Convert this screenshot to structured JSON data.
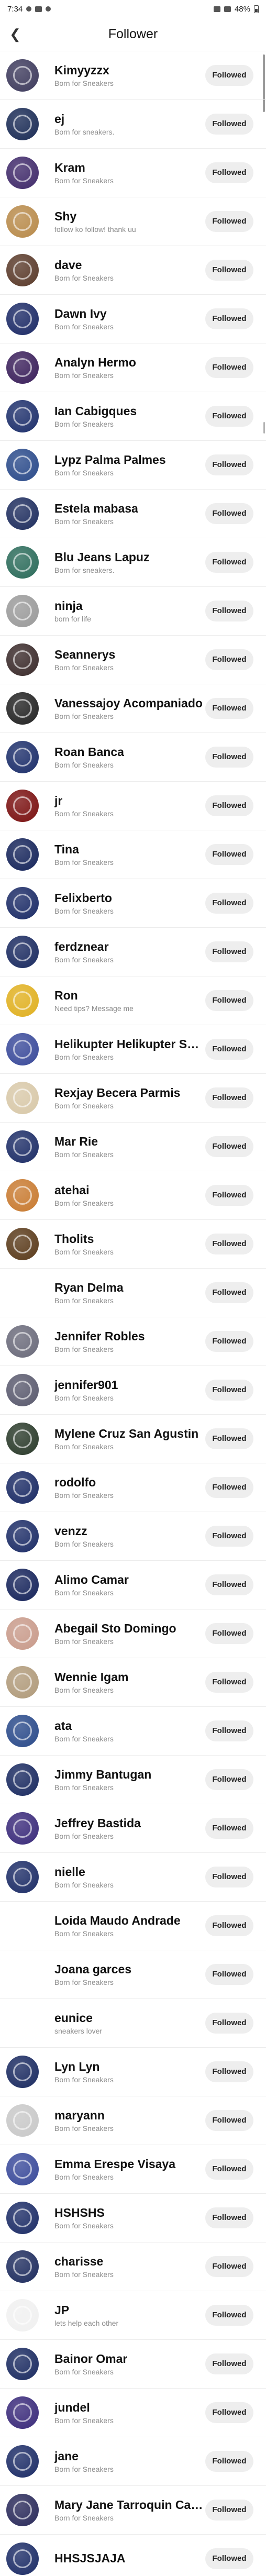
{
  "status": {
    "time": "7:34",
    "battery": "48%"
  },
  "header": {
    "title": "Follower",
    "back_icon": "back-arrow-icon"
  },
  "colors": {
    "button_bg": "#eeeeee",
    "subtitle": "#8c8c8c"
  },
  "followers": [
    {
      "name": "Kimyyzzx",
      "subtitle": "Born for Sneakers",
      "button": "Followed",
      "avatar_color": "#3d3a5c"
    },
    {
      "name": "ej",
      "subtitle": "Born for sneakers.",
      "button": "Followed",
      "avatar_color": "#1a2b55"
    },
    {
      "name": "Kram",
      "subtitle": "Born for Sneakers",
      "button": "Followed",
      "avatar_color": "#402a6a"
    },
    {
      "name": "Shy",
      "subtitle": "follow ko follow! thank uu",
      "button": "Followed",
      "avatar_color": "#b88a4a"
    },
    {
      "name": "dave",
      "subtitle": "Born for Sneakers",
      "button": "Followed",
      "avatar_color": "#5a3a2a"
    },
    {
      "name": "Dawn Ivy",
      "subtitle": "Born for Sneakers",
      "button": "Followed",
      "avatar_color": "#1c2a66"
    },
    {
      "name": "Analyn Hermo",
      "subtitle": "Born for Sneakers",
      "button": "Followed",
      "avatar_color": "#3a1f5a"
    },
    {
      "name": "Ian Cabigques",
      "subtitle": "Born for Sneakers",
      "button": "Followed",
      "avatar_color": "#1d2f6b"
    },
    {
      "name": "Lypz Palma Palmes",
      "subtitle": "Born for Sneakers",
      "button": "Followed",
      "avatar_color": "#2a4a8a"
    },
    {
      "name": "Estela mabasa",
      "subtitle": "Born for Sneakers",
      "button": "Followed",
      "avatar_color": "#1e2d5e"
    },
    {
      "name": "Blu Jeans Lapuz",
      "subtitle": "Born for sneakers.",
      "button": "Followed",
      "avatar_color": "#2b6b5a"
    },
    {
      "name": "ninja",
      "subtitle": "born for life",
      "button": "Followed",
      "avatar_color": "#9a9a9a"
    },
    {
      "name": "Seannerys",
      "subtitle": "Born for Sneakers",
      "button": "Followed",
      "avatar_color": "#3a2a2a"
    },
    {
      "name": "Vanessajoy Acompaniado",
      "subtitle": "Born for Sneakers",
      "button": "Followed",
      "avatar_color": "#222222"
    },
    {
      "name": "Roan Banca",
      "subtitle": "Born for Sneakers",
      "button": "Followed",
      "avatar_color": "#1c2e6a"
    },
    {
      "name": "jr",
      "subtitle": "Born for Sneakers",
      "button": "Followed",
      "avatar_color": "#7a1010"
    },
    {
      "name": "Tina",
      "subtitle": "Born for Sneakers",
      "button": "Followed",
      "avatar_color": "#15245a"
    },
    {
      "name": "Felixberto",
      "subtitle": "Born for Sneakers",
      "button": "Followed",
      "avatar_color": "#1b2b66"
    },
    {
      "name": "ferdznear",
      "subtitle": "Born for Sneakers",
      "button": "Followed",
      "avatar_color": "#1a2a60"
    },
    {
      "name": "Ron",
      "subtitle": "Need tips? Message me",
      "button": "Followed",
      "avatar_color": "#e0b020"
    },
    {
      "name": "Helikupter Helikupter Sarmiento",
      "subtitle": "Born for Sneakers",
      "button": "Followed",
      "avatar_color": "#3a4a9a"
    },
    {
      "name": "Rexjay Becera Parmis",
      "subtitle": "Born for Sneakers",
      "button": "Followed",
      "avatar_color": "#d8c8a8"
    },
    {
      "name": "Mar Rie",
      "subtitle": "Born for Sneakers",
      "button": "Followed",
      "avatar_color": "#1c2c66"
    },
    {
      "name": "atehai",
      "subtitle": "Born for Sneakers",
      "button": "Followed",
      "avatar_color": "#c87a30"
    },
    {
      "name": "Tholits",
      "subtitle": "Born for Sneakers",
      "button": "Followed",
      "avatar_color": "#5a3a1a"
    },
    {
      "name": "Ryan Delma",
      "subtitle": "Born for Sneakers",
      "button": "Followed",
      "avatar_color": "#ffffff"
    },
    {
      "name": "Jennifer Robles",
      "subtitle": "Born for Sneakers",
      "button": "Followed",
      "avatar_color": "#6a6a7a"
    },
    {
      "name": "jennifer901",
      "subtitle": "Born for Sneakers",
      "button": "Followed",
      "avatar_color": "#5a5a6e"
    },
    {
      "name": "Mylene Cruz San Agustin",
      "subtitle": "Born for Sneakers",
      "button": "Followed",
      "avatar_color": "#2a3a2a"
    },
    {
      "name": "rodolfo",
      "subtitle": "Born for Sneakers",
      "button": "Followed",
      "avatar_color": "#1a2a64"
    },
    {
      "name": "venzz",
      "subtitle": "Born for Sneakers",
      "button": "Followed",
      "avatar_color": "#1c2c66"
    },
    {
      "name": "Alimo Camar",
      "subtitle": "Born for Sneakers",
      "button": "Followed",
      "avatar_color": "#15235a"
    },
    {
      "name": "Abegail Sto Domingo",
      "subtitle": "Born for Sneakers",
      "button": "Followed",
      "avatar_color": "#c89a8a"
    },
    {
      "name": "Wennie Igam",
      "subtitle": "Born for Sneakers",
      "button": "Followed",
      "avatar_color": "#b09a7a"
    },
    {
      "name": "ata",
      "subtitle": "Born for Sneakers",
      "button": "Followed",
      "avatar_color": "#2a4a8a"
    },
    {
      "name": "Jimmy Bantugan",
      "subtitle": "Born for Sneakers",
      "button": "Followed",
      "avatar_color": "#1a2a60"
    },
    {
      "name": "Jeffrey Bastida",
      "subtitle": "Born for Sneakers",
      "button": "Followed",
      "avatar_color": "#3a2a7a"
    },
    {
      "name": "nielle",
      "subtitle": "Born for Sneakers",
      "button": "Followed",
      "avatar_color": "#1c2c66"
    },
    {
      "name": "Loida Maudo Andrade",
      "subtitle": "Born for Sneakers",
      "button": "Followed",
      "avatar_color": "#ffffff"
    },
    {
      "name": "Joana garces",
      "subtitle": "Born for Sneakers",
      "button": "Followed",
      "avatar_color": "#ffffff"
    },
    {
      "name": "eunice",
      "subtitle": "sneakers lover",
      "button": "Followed",
      "avatar_color": "#ffffff"
    },
    {
      "name": "Lyn Lyn",
      "subtitle": "Born for Sneakers",
      "button": "Followed",
      "avatar_color": "#1a2a60"
    },
    {
      "name": "maryann",
      "subtitle": "Born for Sneakers",
      "button": "Followed",
      "avatar_color": "#c8c8c8"
    },
    {
      "name": "Emma Erespe Visaya",
      "subtitle": "Born for Sneakers",
      "button": "Followed",
      "avatar_color": "#3a4a9a"
    },
    {
      "name": "HSHSHS",
      "subtitle": "Born for Sneakers",
      "button": "Followed",
      "avatar_color": "#1c2c66"
    },
    {
      "name": "charisse",
      "subtitle": "Born for Sneakers",
      "button": "Followed",
      "avatar_color": "#1e2c5e"
    },
    {
      "name": "JP",
      "subtitle": "lets help each other",
      "button": "Followed",
      "avatar_color": "#f0f0f0"
    },
    {
      "name": "Bainor Omar",
      "subtitle": "Born for Sneakers",
      "button": "Followed",
      "avatar_color": "#1a2a60"
    },
    {
      "name": "jundel",
      "subtitle": "Born for Sneakers",
      "button": "Followed",
      "avatar_color": "#3a2a7a"
    },
    {
      "name": "jane",
      "subtitle": "Born for Sneakers",
      "button": "Followed",
      "avatar_color": "#1c2c66"
    },
    {
      "name": "Mary Jane Tarroquin Caingay",
      "subtitle": "Born for Sneakers",
      "button": "Followed",
      "avatar_color": "#2a2a5a"
    },
    {
      "name": "HHSJSJAJA",
      "subtitle": "",
      "button": "Followed",
      "avatar_color": "#1c2c66"
    }
  ]
}
